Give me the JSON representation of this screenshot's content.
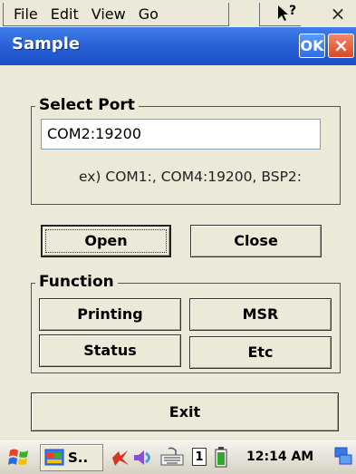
{
  "menubar": {
    "items": [
      "File",
      "Edit",
      "View",
      "Go"
    ],
    "help_icon": "help-pointer-icon",
    "close_label": "×"
  },
  "window": {
    "title": "Sample",
    "ok_label": "OK",
    "close_label": "×"
  },
  "select_port": {
    "legend": "Select Port",
    "input_value": "COM2:19200",
    "hint": "ex) COM1:, COM4:19200, BSP2:"
  },
  "buttons": {
    "open": "Open",
    "close": "Close",
    "exit": "Exit"
  },
  "function": {
    "legend": "Function",
    "printing": "Printing",
    "msr": "MSR",
    "status": "Status",
    "etc": "Etc"
  },
  "taskbar": {
    "start_icon": "windows-flag-icon",
    "task_label": "S..",
    "tray_number": "1",
    "clock": "12:14 AM",
    "desktop_icon": "show-desktop-icon"
  },
  "colors": {
    "titlebar": "#2b63d9",
    "ok_button": "#3b7ef0",
    "close_button": "#e0562f",
    "background": "#ece9d8"
  }
}
